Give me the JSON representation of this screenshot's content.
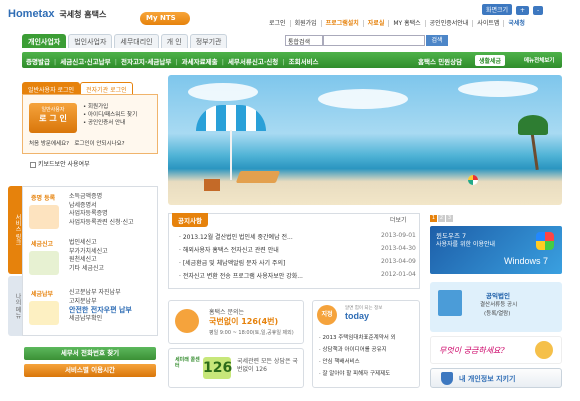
{
  "header": {
    "logo_text": "Hometax",
    "logo_sub": "국세청 홈택스",
    "mynts": "My NTS",
    "screen_label": "화면크기",
    "plus": "+",
    "minus": "-",
    "top_links": [
      {
        "label": "로그인"
      },
      {
        "label": "회원가입"
      },
      {
        "label": "프로그램설치"
      },
      {
        "label": "자료실"
      },
      {
        "label": "MY 홈택스"
      },
      {
        "label": "공인인증서안내"
      },
      {
        "label": "사이트맵"
      }
    ],
    "nts_label": "국세청"
  },
  "tabs": [
    "개인사업자",
    "법인사업자",
    "세무대리인",
    "개 인",
    "정부기관"
  ],
  "search": {
    "select_value": "통합검색",
    "button": "검색",
    "placeholder": ""
  },
  "gnav": {
    "items": [
      "증명발급",
      "세금신고·신고납부",
      "전자고지·세금납부",
      "과세자료제출",
      "세무서류신고·신청",
      "조회서비스"
    ],
    "civil": "홈택스 민원상담",
    "life": "생활세금",
    "menu": "메뉴전체보기"
  },
  "login": {
    "tab_active": "일반사용자 로그인",
    "tab_other": "전자기관 로그인",
    "btn_small": "일반사용자",
    "btn_big": "로 그 인",
    "links": [
      "회원가입",
      "아이디/패스워드 찾기",
      "공인인증서 안내"
    ],
    "foot1": "처음 방문에세요?",
    "foot2": "로그인이 안되시나요?"
  },
  "keyboard": "키보드보안 사용여부",
  "side_tab1": "서비스 링크",
  "side_tab2": "나의 메뉴",
  "services": [
    {
      "name": "증명 등록",
      "items": [
        "소득금액증명",
        "납세증명서",
        "사업자등록증명",
        "사업자등록관련 신청·신고"
      ]
    },
    {
      "name": "세금신고",
      "items": [
        "법인세신고",
        "부가가치세신고",
        "원천세신고",
        "기타 세금신고"
      ]
    },
    {
      "name": "세금납부",
      "items": [
        "신고분납부  자진납부",
        "고지분납부",
        "안전한 전자우편 납부",
        "세금납부확인"
      ]
    }
  ],
  "btn_phone": "세무서 전화번호 찾기",
  "btn_hours": "서비스별 이용시간",
  "notice": {
    "tab": "공지사항",
    "more": "더보기",
    "rows": [
      {
        "title": "· 2013.12월 결산법인 법인세 중간예납 전...",
        "date": "2013-09-01"
      },
      {
        "title": "· 해외사용자 홈택스 전자신고 관련 안내",
        "date": "2013-04-30"
      },
      {
        "title": "· [세금환급 및 체납액알림 문자 사기 주의]",
        "date": "2013-04-09"
      },
      {
        "title": "· 전자신고 변환 전송 프로그램 사용자보안 강화...",
        "date": "2012-01-04"
      }
    ]
  },
  "winad": {
    "pages": [
      "1",
      "2",
      "3"
    ],
    "t1": "윈도우즈 7",
    "t2": "사용자를 위한 이용안내",
    "w7": "Windows 7"
  },
  "cc1": {
    "t1": "홈택스 문의는",
    "t2": "국번없이 126(4번)",
    "t3": "평일 9:00 ~ 18:00(토,일,공휴일 제외)"
  },
  "cc2": {
    "lbl": "세미래 콜센터",
    "num": "126",
    "t1": "국세관련 모든 상담은 국번없이 126"
  },
  "today": {
    "stamp": "지정",
    "small": "알면 힘이 되는 정보",
    "title": "today",
    "lines": [
      "· 2013 주택임대차표준계약서 외",
      "· 상담책과 아이디어를 공유지",
      "· 안심 책배서비스",
      "· 잘 알아야 할 피해자 구제제도"
    ]
  },
  "corpad": {
    "t1": "공익법인",
    "t2": "결산서류등 공시",
    "t3": "(등록/열람)"
  },
  "handad": {
    "text": "무엇이 궁금하세요?"
  },
  "privacy": {
    "text": "내 개인정보 지키기"
  }
}
